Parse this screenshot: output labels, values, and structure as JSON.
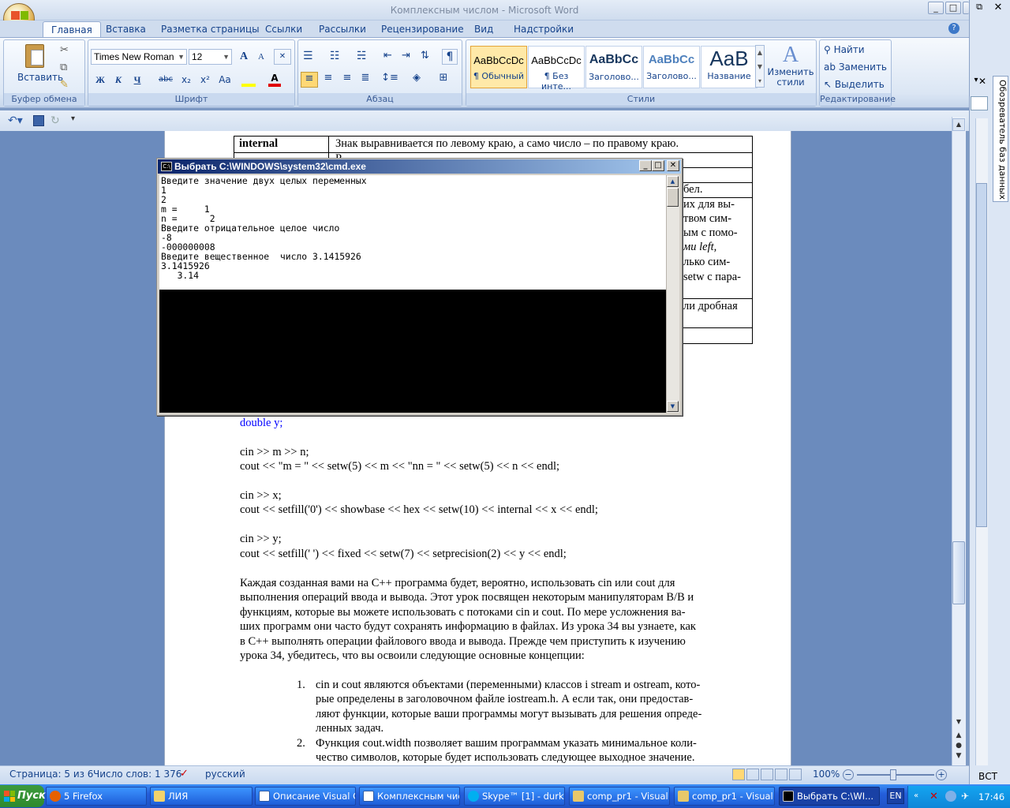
{
  "window": {
    "title": "Комплексным числом - Microsoft Word"
  },
  "tabs": [
    "Главная",
    "Вставка",
    "Разметка страницы",
    "Ссылки",
    "Рассылки",
    "Рецензирование",
    "Вид",
    "Надстройки"
  ],
  "clipboard": {
    "paste_label": "Вставить",
    "group_label": "Буфер обмена"
  },
  "font": {
    "family": "Times New Roman",
    "size": "12",
    "group_label": "Шрифт",
    "bold": "Ж",
    "italic": "К",
    "underline": "Ч",
    "strike": "abc",
    "sub": "x₂",
    "sup": "x²",
    "case": "Aa",
    "grow": "A",
    "shrink": "A"
  },
  "paragraph": {
    "group_label": "Абзац",
    "pilcrow": "¶"
  },
  "styles": {
    "group_label": "Стили",
    "items": [
      {
        "sample": "AaBbCcDc",
        "name": "¶ Обычный"
      },
      {
        "sample": "AaBbCcDc",
        "name": "¶ Без инте..."
      },
      {
        "sample": "AaBbCc",
        "name": "Заголово..."
      },
      {
        "sample": "AaBbCc",
        "name": "Заголово..."
      },
      {
        "sample": "AaB",
        "name": "Название"
      }
    ],
    "change_label": "Изменить стили"
  },
  "editing": {
    "group_label": "Редактирование",
    "find": "Найти",
    "replace": "Заменить",
    "select": "Выделить"
  },
  "right_pane": {
    "label": "Обозреватель баз данных"
  },
  "doc": {
    "table_rows": [
      {
        "key": "internal",
        "value": "Знак выравнивается по левому краю, а само число – по правому краю."
      },
      {
        "key": "",
        "value": "Р"
      },
      {
        "key": "",
        "value": ""
      },
      {
        "key": "",
        "value": "бел."
      },
      {
        "key": "",
        "value": "их для вы-"
      },
      {
        "key": "",
        "value": "твом сим-"
      },
      {
        "key": "",
        "value": "ым с помо-"
      },
      {
        "key": "",
        "value": "ми left,"
      },
      {
        "key": "",
        "value": "лько сим-"
      },
      {
        "key": "",
        "value": "setw с пара-"
      },
      {
        "key": "",
        "value": "ли дробная"
      }
    ],
    "code_lines": [
      "double y;",
      "",
      "cin  >> m >> n;",
      "cout << \"m = \" << setw(5) << m << \"nn = \" << setw(5) << n << endl;",
      "",
      "cin  >> x;",
      "cout << setfill('0') << showbase << hex << setw(10) << internal << x << endl;",
      "",
      "cin  >> y;",
      "cout << setfill(' ') << fixed << setw(7) << setprecision(2)  << y << endl;"
    ],
    "paragraph": [
      "Каждая созданная вами на С++ программа будет, вероятно, использовать cin или cout для",
      "выполнения операций ввода и вывода. Этот урок посвящен некоторым манипуляторам В/В и",
      "функциям, которые вы можете использовать с потоками cin и cout. По мере усложнения ва-",
      "ших программ они часто будут сохранять информацию в файлах. Из урока 34 вы узнаете, как",
      "в С++ выполнять операции файлового ввода и вывода. Прежде чем приступить к изучению",
      "урока 34, убедитесь, что вы освоили следующие основные концепции:"
    ],
    "list": [
      {
        "num": "1.",
        "lines": [
          "cin и cout являются объектами (переменными) классов i stream и ostream, кото-",
          "рые определены в заголовочном файле iostream.h. А если так, они предостав-",
          "ляют функции, которые ваши программы могут вызывать для решения опреде-",
          "ленных задач."
        ]
      },
      {
        "num": "2.",
        "lines": [
          "Функция cout.width позволяет вашим программам указать минимальное коли-",
          "чество символов, которые будет использовать следующее выходное значение."
        ]
      }
    ]
  },
  "cmd": {
    "title": "Выбрать C:\\WINDOWS\\system32\\cmd.exe",
    "output": "Введите значение двух целых переменных\n1\n2\nm =     1\nn =      2\nВведите отрицательное целое число\n-8\n-000000008\nВведите вещественное  число 3.1415926\n3.1415926\n   3.14\n_"
  },
  "status": {
    "page": "Страница: 5 из 6",
    "words": "Число слов: 1 376",
    "lang": "русский",
    "zoom": "100%"
  },
  "taskbar": {
    "start": "Пуск",
    "items": [
      "5 Firefox",
      "ЛИЯ",
      "Описание Visual C...",
      "Комплексным чис...",
      "Skype™ [1] - durki...",
      "comp_pr1 - Visual ...",
      "comp_pr1 - Visual ...",
      "Выбрать C:\\WI..."
    ],
    "lang": "EN",
    "insert_mode": "ВСТ",
    "clock": "17:46"
  },
  "colors": {
    "accent": "#15428b",
    "taskbar": "#245edb",
    "cmd_title": "#0a246a"
  }
}
